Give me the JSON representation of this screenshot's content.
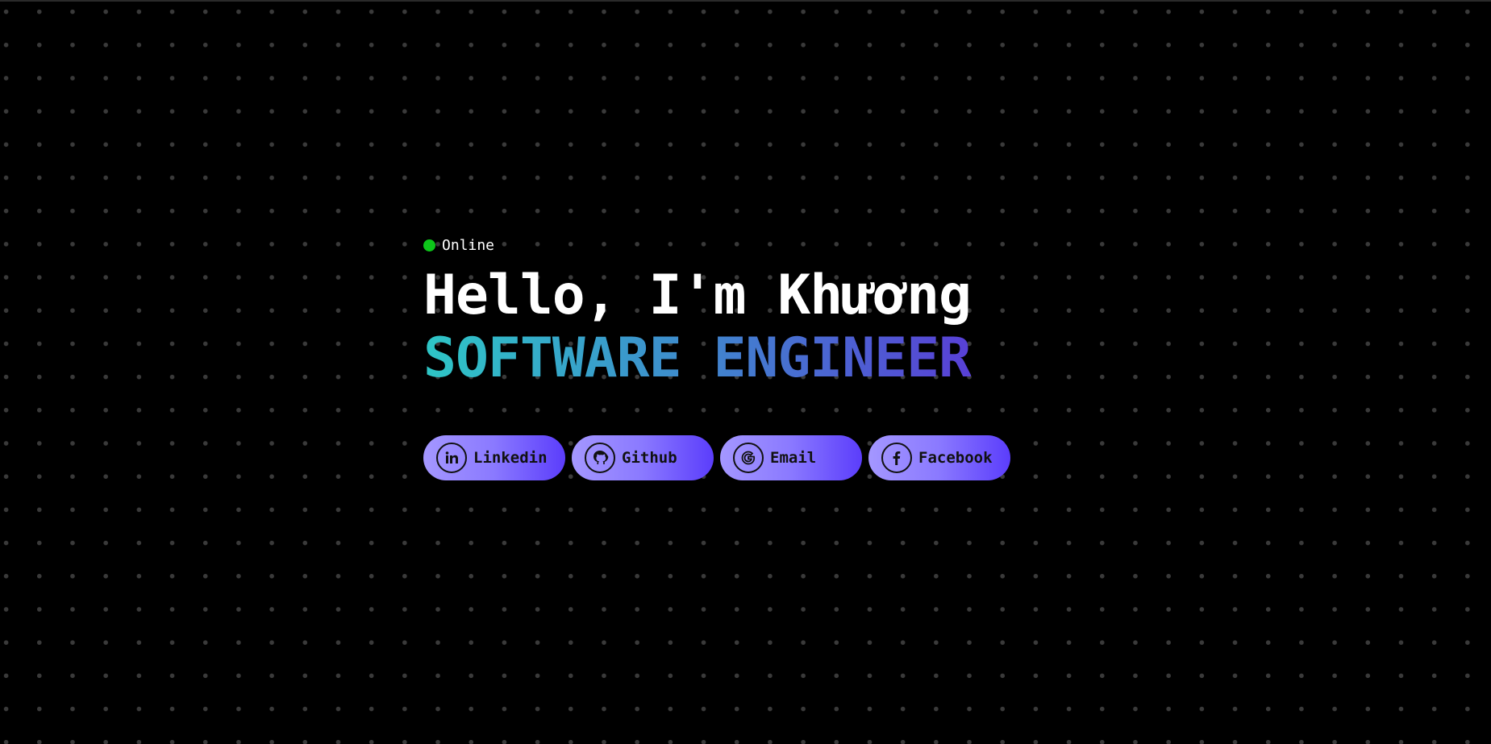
{
  "status": {
    "label": "Online",
    "color": "#0dc61a"
  },
  "hero": {
    "greeting": "Hello, I'm Khương",
    "role": "SOFTWARE ENGINEER",
    "role_gradient": [
      "#2ec6c6",
      "#3d8fcd",
      "#5840d6"
    ]
  },
  "links": [
    {
      "label": "Linkedin",
      "icon": "linkedin-icon"
    },
    {
      "label": "Github",
      "icon": "github-icon"
    },
    {
      "label": "Email",
      "icon": "google-icon"
    },
    {
      "label": "Facebook",
      "icon": "facebook-icon"
    }
  ],
  "button_gradient": [
    "#a497ff",
    "#8a79ff",
    "#5b3dfb"
  ]
}
